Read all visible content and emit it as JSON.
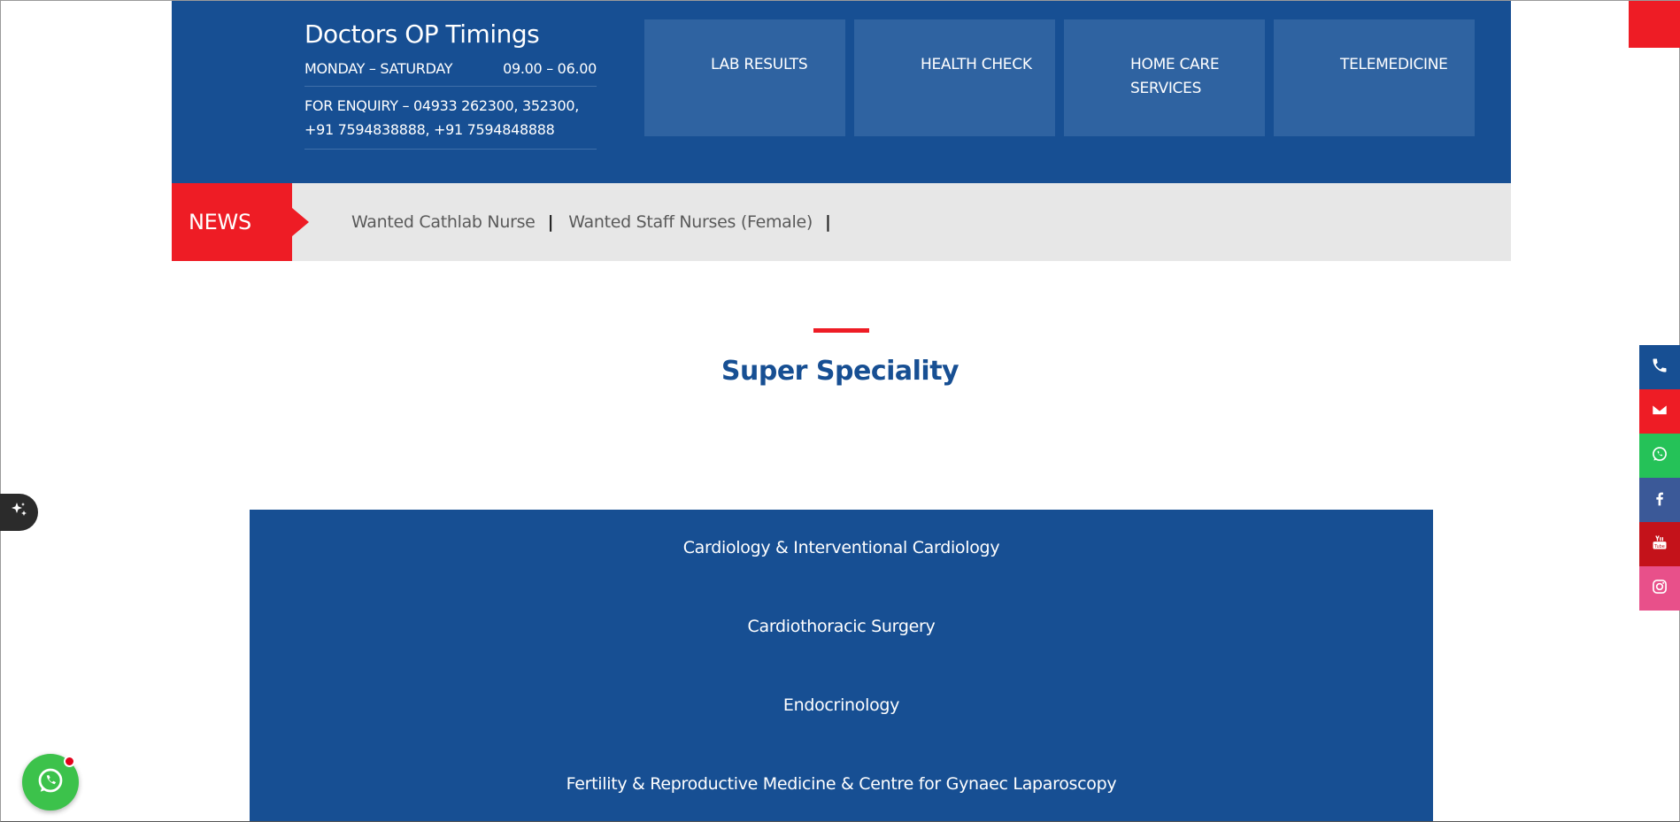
{
  "timings": {
    "title": "Doctors OP Timings",
    "days": "MONDAY – SATURDAY",
    "hours": "09.00 – 06.00",
    "enquiry_line1": "FOR ENQUIRY – 04933 262300, 352300,",
    "enquiry_line2": "+91 7594838888, +91 7594848888"
  },
  "quick_links": [
    {
      "line1": "LAB RESULTS",
      "line2": ""
    },
    {
      "line1": "HEALTH CHECK",
      "line2": ""
    },
    {
      "line1": "HOME CARE",
      "line2": "SERVICES"
    },
    {
      "line1": "TELEMEDICINE",
      "line2": ""
    }
  ],
  "news": {
    "label": "NEWS",
    "items": [
      "Wanted Cathlab Nurse",
      "Wanted Staff Nurses (Female)"
    ],
    "separator": "|"
  },
  "section": {
    "title": "Super Speciality"
  },
  "specialities": [
    "Cardiology & Interventional Cardiology",
    "Cardiothoracic Surgery",
    "Endocrinology",
    "Fertility & Reproductive Medicine & Centre for Gynaec Laparoscopy"
  ],
  "social": [
    {
      "icon": "phone-icon",
      "color": "#174f93"
    },
    {
      "icon": "envelope-icon",
      "color": "#ee1c25"
    },
    {
      "icon": "whatsapp-icon",
      "color": "#25c258"
    },
    {
      "icon": "facebook-icon",
      "color": "#3b5998"
    },
    {
      "icon": "youtube-icon",
      "color": "#c4121a"
    },
    {
      "icon": "instagram-icon",
      "color": "#e8508a"
    }
  ],
  "colors": {
    "brand_blue": "#174f93",
    "accent_red": "#ee1c25",
    "tile_blue": "#2f63a1",
    "news_bg": "#e7e7e7"
  }
}
